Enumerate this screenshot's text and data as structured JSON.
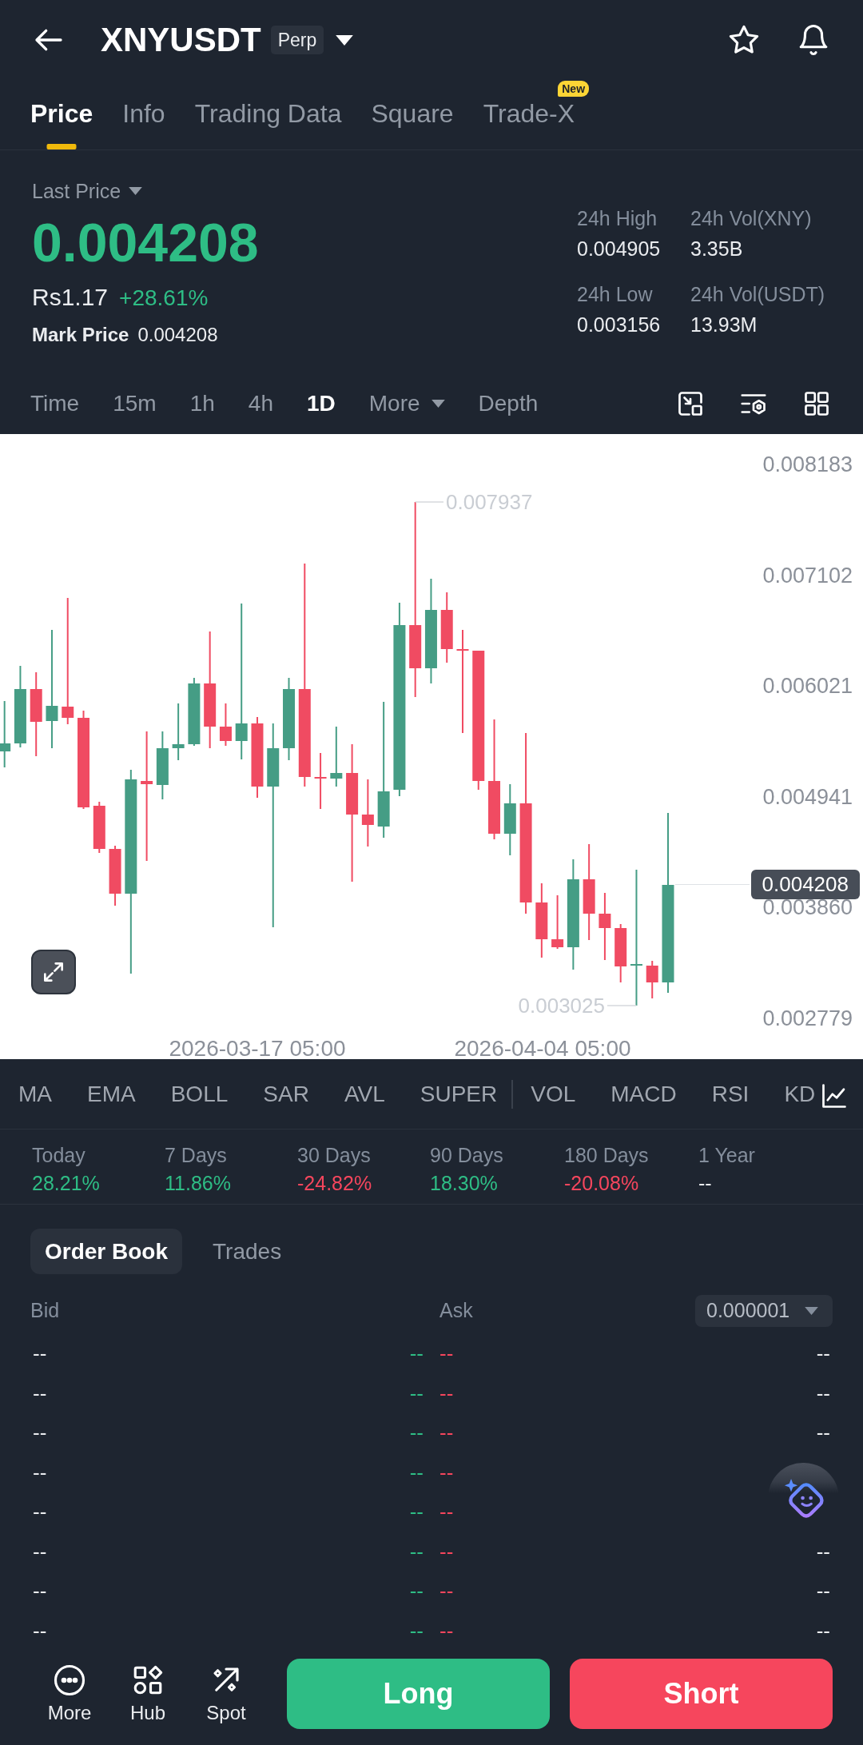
{
  "header": {
    "symbol": "XNYUSDT",
    "contract": "Perp"
  },
  "tabs": [
    {
      "label": "Price",
      "selected": true
    },
    {
      "label": "Info",
      "selected": false
    },
    {
      "label": "Trading Data",
      "selected": false
    },
    {
      "label": "Square",
      "selected": false
    },
    {
      "label": "Trade-X",
      "selected": false,
      "badge": "New"
    }
  ],
  "ticker": {
    "price_type": "Last Price",
    "last_price": "0.004208",
    "fiat_price": "Rs1.17",
    "change": "+28.61%",
    "mark_price_label": "Mark Price",
    "mark_price": "0.004208"
  },
  "stats": [
    {
      "label": "24h High",
      "value": "0.004905"
    },
    {
      "label": "24h Vol(XNY)",
      "value": "3.35B"
    },
    {
      "label": "24h Low",
      "value": "0.003156"
    },
    {
      "label": "24h Vol(USDT)",
      "value": "13.93M"
    }
  ],
  "intervals": [
    {
      "label": "Time",
      "selected": false
    },
    {
      "label": "15m",
      "selected": false
    },
    {
      "label": "1h",
      "selected": false
    },
    {
      "label": "4h",
      "selected": false
    },
    {
      "label": "1D",
      "selected": true
    },
    {
      "label": "More",
      "selected": false,
      "menu": true
    },
    {
      "label": "Depth",
      "selected": false
    }
  ],
  "chart": {
    "price_axis": [
      "0.008183",
      "0.007102",
      "0.006021",
      "0.004941",
      "0.003860",
      "0.002779"
    ],
    "time_axis": [
      "2026-03-17 05:00",
      "2026-04-04 05:00"
    ],
    "high_label": "0.007937",
    "low_label": "0.003025",
    "last_price_tag": "0.004208"
  },
  "indicators": {
    "overlay": [
      "MA",
      "EMA",
      "BOLL",
      "SAR",
      "AVL",
      "SUPER"
    ],
    "sub": [
      "VOL",
      "MACD",
      "RSI",
      "KD"
    ]
  },
  "performance": [
    {
      "label": "Today",
      "value": "28.21%",
      "color": "#2ebd85"
    },
    {
      "label": "7 Days",
      "value": "11.86%",
      "color": "#2ebd85"
    },
    {
      "label": "30 Days",
      "value": "-24.82%",
      "color": "#f6465d"
    },
    {
      "label": "90 Days",
      "value": "18.30%",
      "color": "#2ebd85"
    },
    {
      "label": "180 Days",
      "value": "-20.08%",
      "color": "#f6465d"
    },
    {
      "label": "1 Year",
      "value": "--",
      "color": "#eaecef"
    }
  ],
  "order_book": {
    "tabs": [
      {
        "label": "Order Book",
        "selected": true
      },
      {
        "label": "Trades",
        "selected": false
      }
    ],
    "bid_label": "Bid",
    "ask_label": "Ask",
    "precision": "0.000001",
    "rows": [
      {
        "bid_amount": "--",
        "bid_price": "--",
        "ask_price": "--",
        "ask_amount": "--"
      },
      {
        "bid_amount": "--",
        "bid_price": "--",
        "ask_price": "--",
        "ask_amount": "--"
      },
      {
        "bid_amount": "--",
        "bid_price": "--",
        "ask_price": "--",
        "ask_amount": "--"
      },
      {
        "bid_amount": "--",
        "bid_price": "--",
        "ask_price": "--"
      },
      {
        "bid_amount": "--",
        "bid_price": "--",
        "ask_price": "--"
      },
      {
        "bid_amount": "--",
        "bid_price": "--",
        "ask_price": "--",
        "ask_amount": "--"
      },
      {
        "bid_amount": "--",
        "bid_price": "--",
        "ask_price": "--",
        "ask_amount": "--"
      },
      {
        "bid_amount": "--",
        "bid_price": "--",
        "ask_price": "--",
        "ask_amount": "--"
      }
    ]
  },
  "actions": [
    {
      "label": "More"
    },
    {
      "label": "Hub"
    },
    {
      "label": "Spot"
    }
  ],
  "trade_buttons": {
    "long": "Long",
    "short": "Short"
  }
}
